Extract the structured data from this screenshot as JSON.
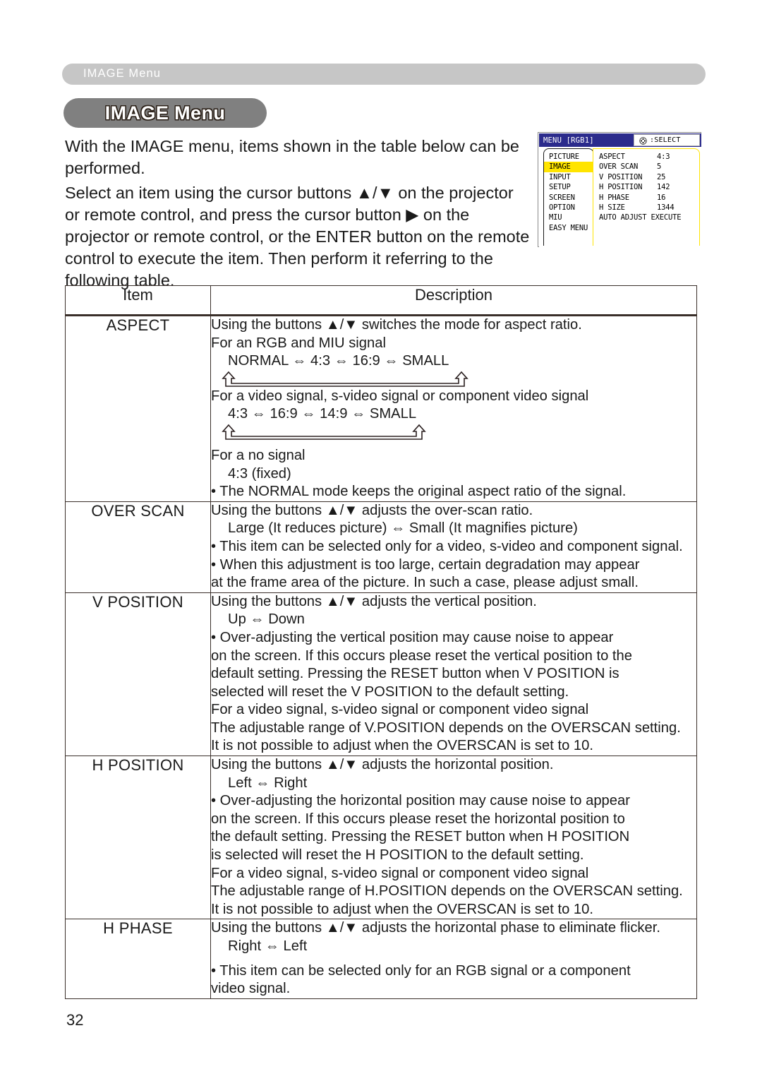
{
  "running_header": {
    "label": "IMAGE Menu"
  },
  "title": {
    "label": "IMAGE Menu"
  },
  "intro": {
    "p1": "With the IMAGE menu, items shown in the table below can be performed.",
    "p2": "Select an item using the cursor buttons ▲/▼ on the projector or remote control, and press the cursor button ▶ on the projector or remote control, or the ENTER button on the remote control to execute the item. Then perform it referring to the following table."
  },
  "osd": {
    "title": "MENU  [RGB1]",
    "select_label": ":SELECT",
    "select_icon": "cursor-pad-icon",
    "menu_items": [
      "PICTURE",
      "IMAGE",
      "INPUT",
      "SETUP",
      "SCREEN",
      "OPTION",
      "MIU",
      "EASY MENU"
    ],
    "selected_item": "IMAGE",
    "highlight_color": "#ffe400",
    "titlebar_color": "#2b2b8c",
    "settings": [
      {
        "name": "ASPECT",
        "value": "4:3"
      },
      {
        "name": "OVER SCAN",
        "value": "5"
      },
      {
        "name": "V POSITION",
        "value": "25"
      },
      {
        "name": "H POSITION",
        "value": "142"
      },
      {
        "name": "H PHASE",
        "value": "16"
      },
      {
        "name": "H SIZE",
        "value": "1344"
      }
    ],
    "action_row": "AUTO ADJUST EXECUTE"
  },
  "table": {
    "headers": {
      "item": "Item",
      "description": "Description"
    },
    "rows": [
      {
        "item": "ASPECT",
        "lines": {
          "l1": "Using the buttons ▲/▼ switches the mode for aspect ratio.",
          "l2": "For an RGB and MIU signal",
          "l3": "NORMAL ⇔ 4:3 ⇔ 16:9 ⇔ SMALL",
          "l4": "For a video signal, s-video signal or component video signal",
          "l5": "4:3 ⇔ 16:9 ⇔ 14:9 ⇔ SMALL",
          "l6": "For a no signal",
          "l7": "4:3 (fixed)",
          "l8": "• The NORMAL mode keeps the original aspect ratio of the signal."
        }
      },
      {
        "item": "OVER SCAN",
        "lines": {
          "l1": "Using the buttons ▲/▼ adjusts the over-scan ratio.",
          "l2": "Large (It reduces picture) ⇔ Small (It magnifies picture)",
          "l3": "• This item can be selected only for a video, s-video and component signal.",
          "l4": "• When this adjustment is too large, certain degradation may appear",
          "l5": "at the frame area of the picture. In such a case, please adjust small."
        }
      },
      {
        "item": "V POSITION",
        "lines": {
          "l1": "Using the buttons ▲/▼ adjusts the vertical position.",
          "l2": "Up ⇔ Down",
          "l3": "• Over-adjusting the vertical position may cause noise to appear",
          "l4": "on the screen. If this occurs please reset the vertical position to the",
          "l5": "default setting. Pressing the RESET button when V POSITION is",
          "l6": "selected will reset the V POSITION to the default setting.",
          "l7": "For a video signal, s-video signal or component video signal",
          "l8": "The adjustable range of V.POSITION depends on the OVERSCAN setting.",
          "l9": "It is not possible to adjust when the OVERSCAN is set to 10."
        }
      },
      {
        "item": "H POSITION",
        "lines": {
          "l1": "Using the buttons ▲/▼ adjusts the horizontal position.",
          "l2": "Left ⇔ Right",
          "l3": "• Over-adjusting the horizontal position may cause noise to appear",
          "l4": "on the screen. If this occurs please reset the horizontal position to",
          "l5": "the default setting. Pressing the RESET button when H POSITION",
          "l6": "is selected will reset the H POSITION to the default setting.",
          "l7": "For a video signal, s-video signal or component video signal",
          "l8": "The adjustable range of H.POSITION depends on the OVERSCAN setting.",
          "l9": "It is not possible to adjust when the OVERSCAN is set to 10."
        }
      },
      {
        "item": "H PHASE",
        "lines": {
          "l1": "Using the buttons ▲/▼ adjusts the horizontal phase to eliminate flicker.",
          "l2": "Right ⇔ Left",
          "l3": "• This item can be selected only for an RGB signal or a component",
          "l4": "video signal."
        }
      }
    ]
  },
  "page_number": "32"
}
